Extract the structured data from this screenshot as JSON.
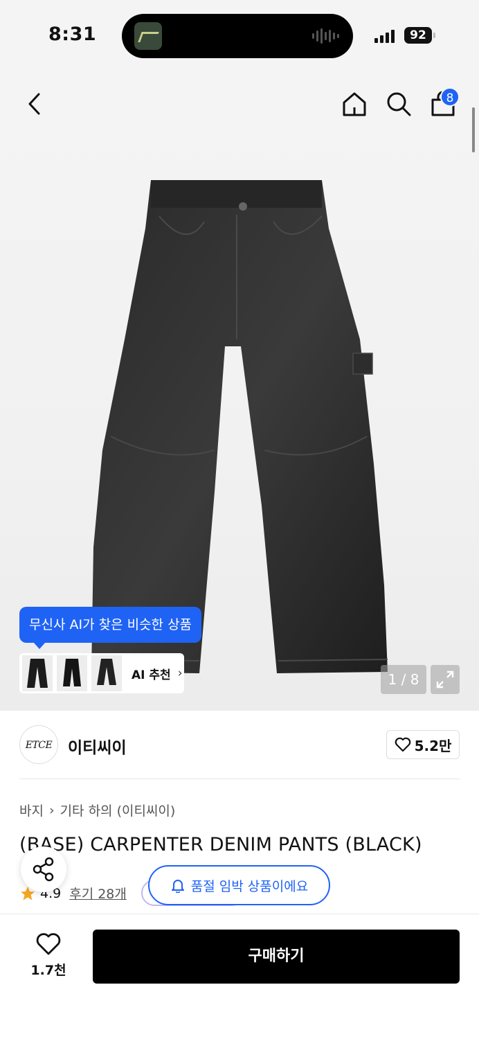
{
  "status_bar": {
    "time": "8:31",
    "battery": "92"
  },
  "nav": {
    "back_icon": "chevron-left-icon",
    "home_icon": "home-icon",
    "search_icon": "search-icon",
    "cart_icon": "shopping-bag-icon",
    "cart_count": "8"
  },
  "gallery": {
    "ai_tooltip": "무신사 AI가 찾은 비슷한 상품",
    "ai_recommend_label": "AI 추천",
    "page_indicator": "1 / 8"
  },
  "brand": {
    "logo_text": "ETCE",
    "name": "이티씨이",
    "like_count": "5.2만"
  },
  "product": {
    "breadcrumb": [
      "바지",
      "기타 하의 (이티씨이)"
    ],
    "title": "(BASE) CARPENTER DENIM PANTS (BLACK)",
    "rating": "4.9",
    "review_link": "후기 28개"
  },
  "toast": {
    "text": "품절 임박 상품이에요"
  },
  "bottom": {
    "wish_count": "1.7천",
    "buy_label": "구매하기"
  },
  "colors": {
    "accent": "#1f63f5",
    "buy_button": "#000000",
    "star": "#f5a623"
  }
}
